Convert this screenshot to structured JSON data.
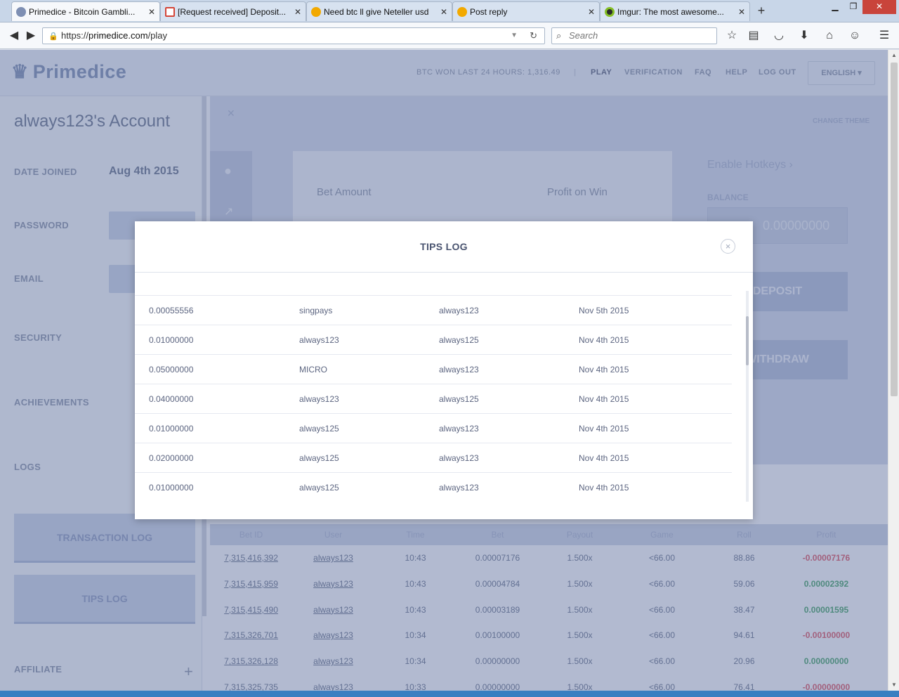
{
  "browser": {
    "tabs": [
      {
        "title": "Primedice - Bitcoin Gambli...",
        "active": true,
        "icon": "primedice-crown-icon"
      },
      {
        "title": "[Request received] Deposit...",
        "active": false,
        "icon": "gmail-icon"
      },
      {
        "title": "Need btc ll give Neteller usd",
        "active": false,
        "icon": "bitcoin-forum-icon"
      },
      {
        "title": "Post reply",
        "active": false,
        "icon": "bitcoin-forum-icon"
      },
      {
        "title": "Imgur: The most awesome...",
        "active": false,
        "icon": "imgur-icon"
      }
    ],
    "url_prefix": "https://",
    "url_domain": "primedice.com",
    "url_path": "/play",
    "search_placeholder": "Search"
  },
  "site": {
    "logo_text": "Primedice",
    "btc_won": "BTC WON LAST 24 HOURS: 1,316.49",
    "nav": [
      "PLAY",
      "VERIFICATION",
      "FAQ",
      "HELP",
      "LOG OUT"
    ],
    "language": "ENGLISH"
  },
  "sidebar": {
    "account_title": "always123's Account",
    "date_joined_label": "DATE JOINED",
    "date_joined_value": "Aug 4th 2015",
    "password_label": "PASSWORD",
    "email_label": "EMAIL",
    "security_label": "SECURITY",
    "achievements_label": "ACHIEVEMENTS",
    "logs_label": "LOGS",
    "transaction_log_button": "TRANSACTION LOG",
    "tips_log_button": "TIPS LOG",
    "affiliate_label": "AFFILIATE"
  },
  "game": {
    "change_theme": "CHANGE THEME",
    "bet_amount_label": "Bet Amount",
    "profit_on_win_label": "Profit on Win",
    "enable_hotkeys": "Enable Hotkeys",
    "balance_label": "BALANCE",
    "balance_value": "0.00000000",
    "deposit_button": "DEPOSIT",
    "withdraw_button": "WITHDRAW"
  },
  "bets_table": {
    "headers": [
      "Bet ID",
      "User",
      "Time",
      "Bet",
      "Payout",
      "Game",
      "Roll",
      "Profit"
    ],
    "rows": [
      {
        "bet_id": "7,315,416,392",
        "user": "always123",
        "time": "10:43",
        "bet": "0.00007176",
        "payout": "1.500x",
        "game": "<66.00",
        "roll": "88.86",
        "profit": "-0.00007176",
        "positive": false
      },
      {
        "bet_id": "7,315,415,959",
        "user": "always123",
        "time": "10:43",
        "bet": "0.00004784",
        "payout": "1.500x",
        "game": "<66.00",
        "roll": "59.06",
        "profit": "0.00002392",
        "positive": true
      },
      {
        "bet_id": "7,315,415,490",
        "user": "always123",
        "time": "10:43",
        "bet": "0.00003189",
        "payout": "1.500x",
        "game": "<66.00",
        "roll": "38.47",
        "profit": "0.00001595",
        "positive": true
      },
      {
        "bet_id": "7,315,326,701",
        "user": "always123",
        "time": "10:34",
        "bet": "0.00100000",
        "payout": "1.500x",
        "game": "<66.00",
        "roll": "94.61",
        "profit": "-0.00100000",
        "positive": false
      },
      {
        "bet_id": "7,315,326,128",
        "user": "always123",
        "time": "10:34",
        "bet": "0.00000000",
        "payout": "1.500x",
        "game": "<66.00",
        "roll": "20.96",
        "profit": "0.00000000",
        "positive": true
      },
      {
        "bet_id": "7,315,325,735",
        "user": "always123",
        "time": "10:33",
        "bet": "0.00000000",
        "payout": "1.500x",
        "game": "<66.00",
        "roll": "76.41",
        "profit": "-0.00000000",
        "positive": false
      }
    ]
  },
  "modal": {
    "title": "TIPS LOG",
    "rows": [
      {
        "amount": "0.00055556",
        "from": "singpays",
        "to": "always123",
        "date": "Nov 5th 2015"
      },
      {
        "amount": "0.01000000",
        "from": "always123",
        "to": "always125",
        "date": "Nov 4th 2015"
      },
      {
        "amount": "0.05000000",
        "from": "MICRO",
        "to": "always123",
        "date": "Nov 4th 2015"
      },
      {
        "amount": "0.04000000",
        "from": "always123",
        "to": "always125",
        "date": "Nov 4th 2015"
      },
      {
        "amount": "0.01000000",
        "from": "always125",
        "to": "always123",
        "date": "Nov 4th 2015"
      },
      {
        "amount": "0.02000000",
        "from": "always125",
        "to": "always123",
        "date": "Nov 4th 2015"
      },
      {
        "amount": "0.01000000",
        "from": "always125",
        "to": "always123",
        "date": "Nov 4th 2015"
      }
    ]
  },
  "colors": {
    "overlay": "#5868968a",
    "accent": "#7e8fb3",
    "profit_negative": "#d85a6a",
    "profit_positive": "#49a36d"
  }
}
